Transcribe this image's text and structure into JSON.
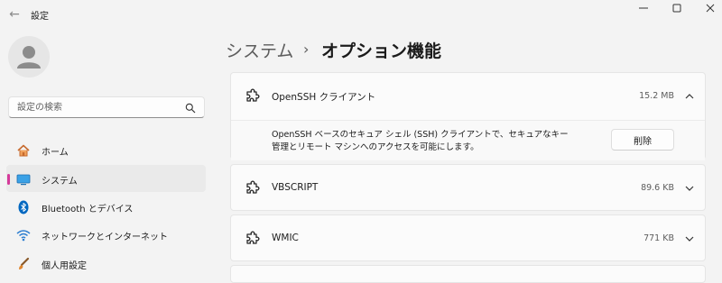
{
  "window": {
    "title": "設定"
  },
  "search": {
    "placeholder": "設定の検索"
  },
  "sidebar": {
    "items": [
      {
        "label": "ホーム",
        "icon": "home-icon"
      },
      {
        "label": "システム",
        "icon": "monitor-icon",
        "selected": true
      },
      {
        "label": "Bluetooth とデバイス",
        "icon": "bluetooth-icon"
      },
      {
        "label": "ネットワークとインターネット",
        "icon": "wifi-icon"
      },
      {
        "label": "個人用設定",
        "icon": "brush-icon"
      }
    ]
  },
  "breadcrumb": {
    "parent": "システム",
    "separator": "›",
    "current": "オプション機能"
  },
  "features": [
    {
      "name": "OpenSSH クライアント",
      "size": "15.2 MB",
      "expanded": true,
      "description": "OpenSSH ベースのセキュア シェル (SSH) クライアントで、セキュアなキー管理とリモート マシンへのアクセスを可能にします。",
      "action_label": "削除"
    },
    {
      "name": "VBSCRIPT",
      "size": "89.6 KB",
      "expanded": false
    },
    {
      "name": "WMIC",
      "size": "771 KB",
      "expanded": false
    }
  ],
  "colors": {
    "background": "#f3f3f3",
    "card": "#fbfbfb",
    "selection_indicator": "#d53a9a",
    "accent_blue": "#0067c0"
  }
}
